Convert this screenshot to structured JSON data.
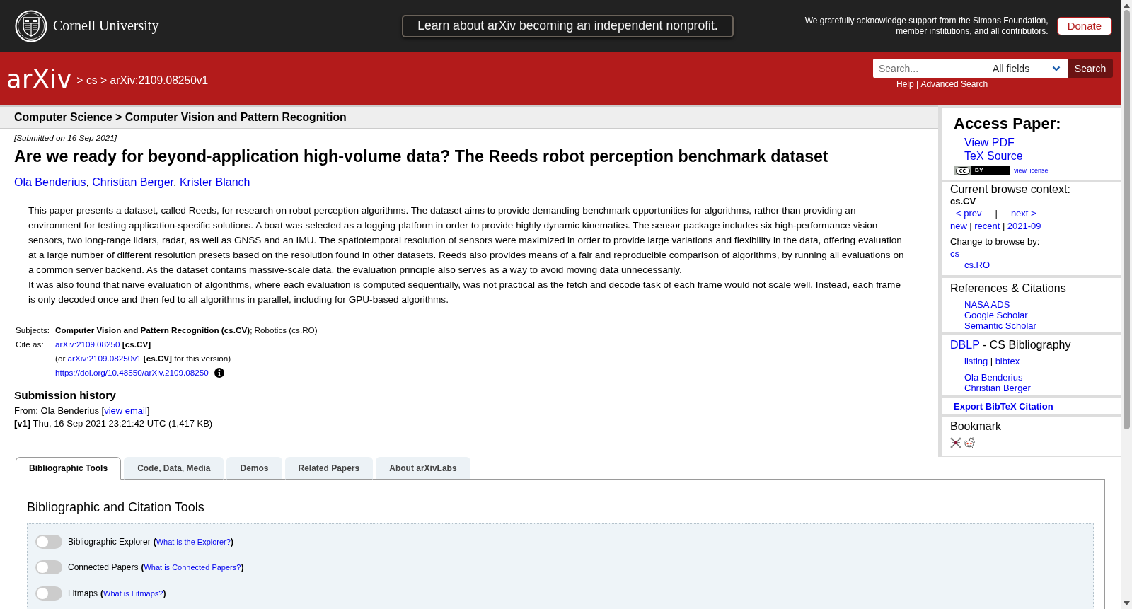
{
  "top_bar": {
    "university": "Cornell University",
    "announcement": "Learn about arXiv becoming an independent nonprofit.",
    "support_text": [
      {
        "kind": "text",
        "text": "We gratefully acknowledge support from the Simons Foundation, "
      },
      {
        "kind": "link",
        "text": "member institutions"
      },
      {
        "kind": "text",
        "text": ", and all contributors."
      }
    ],
    "donate_button": "Donate"
  },
  "header": {
    "logo": "arXiv",
    "breadcrumbs": [
      {
        "kind": "text",
        "text": ">"
      },
      {
        "kind": "link",
        "text": "cs"
      },
      {
        "kind": "text",
        "text": ">"
      },
      {
        "kind": "link",
        "text": "arXiv:2109.08250v1"
      }
    ],
    "search": {
      "placeholder": "Search...",
      "field": "All fields",
      "button": "Search"
    },
    "help_links": [
      {
        "kind": "link",
        "text": "Help"
      },
      {
        "kind": "text",
        "text": "|"
      },
      {
        "kind": "link",
        "text": "Advanced Search"
      }
    ]
  },
  "category_bar": "Computer Science > Computer Vision and Pattern Recognition",
  "paper": {
    "submitted": "[Submitted on 16 Sep 2021]",
    "title": "Are we ready for beyond-application high-volume data? The Reeds robot perception benchmark dataset",
    "authors": [
      {
        "kind": "link",
        "text": "Ola Benderius"
      },
      {
        "kind": "text",
        "text": ", "
      },
      {
        "kind": "link",
        "text": "Christian Berger"
      },
      {
        "kind": "text",
        "text": ", "
      },
      {
        "kind": "link",
        "text": "Krister Blanch"
      }
    ],
    "abstract": [
      "This paper presents a dataset, called Reeds, for research on robot perception algorithms. The dataset aims to provide demanding benchmark opportunities for algorithms, rather than providing an environment for testing application-specific solutions. A boat was selected as a logging platform in order to provide highly dynamic kinematics. The sensor package includes six high-performance vision sensors, two long-range lidars, radar, as well as GNSS and an IMU. The spatiotemporal resolution of sensors were maximized in order to provide large variations and flexibility in the data, offering evaluation at a large number of different resolution presets based on the resolution found in other datasets. Reeds also provides means of a fair and reproducible comparison of algorithms, by running all evaluations on a common server backend. As the dataset contains massive-scale data, the evaluation principle also serves as a way to avoid moving data unnecessarily.",
      "It was also found that naive evaluation of algorithms, where each evaluation is computed sequentially, was not practical as the fetch and decode task of each frame would not scale well. Instead, each frame is only decoded once and then fed to all algorithms in parallel, including for GPU-based algorithms."
    ],
    "metadata": [
      {
        "label": "Subjects:",
        "lines": [
          [
            {
              "kind": "bold",
              "text": "Computer Vision and Pattern Recognition (cs.CV)"
            },
            {
              "kind": "text",
              "text": "; Robotics (cs.RO)"
            }
          ]
        ]
      },
      {
        "label": "Cite as:",
        "lines": [
          [
            {
              "kind": "link",
              "text": "arXiv:2109.08250"
            },
            {
              "kind": "bold",
              "text": " [cs.CV]"
            }
          ],
          [
            {
              "kind": "text",
              "text": "(or "
            },
            {
              "kind": "link",
              "text": "arXiv:2109.08250v1"
            },
            {
              "kind": "bold",
              "text": " [cs.CV]"
            },
            {
              "kind": "text",
              "text": " for this version)"
            }
          ],
          [
            {
              "kind": "link",
              "text": "https://doi.org/10.48550/arXiv.2109.08250"
            },
            {
              "kind": "info"
            }
          ]
        ]
      }
    ],
    "submission_history": {
      "heading": "Submission history",
      "from": [
        {
          "kind": "text",
          "text": "From: Ola Benderius ["
        },
        {
          "kind": "link",
          "text": "view email"
        },
        {
          "kind": "text",
          "text": "]"
        }
      ],
      "versions": [
        {
          "version": "[v1]",
          "details": "Thu, 16 Sep 2021 23:21:42 UTC (1,417 KB)"
        }
      ]
    }
  },
  "sidebar": {
    "access_paper": {
      "heading": "Access Paper:",
      "links": [
        "View PDF",
        "TeX Source"
      ],
      "license": {
        "badge": "BY",
        "link": "view license"
      }
    },
    "browse_context": {
      "heading": "Current browse context:",
      "context": "cs.CV",
      "pager": [
        {
          "kind": "link",
          "text": "< prev"
        },
        {
          "kind": "text",
          "text": "|"
        },
        {
          "kind": "link",
          "text": "next >"
        }
      ],
      "lists": [
        {
          "kind": "link",
          "text": "new"
        },
        {
          "kind": "text",
          "text": "|"
        },
        {
          "kind": "link",
          "text": "recent"
        },
        {
          "kind": "text",
          "text": "|"
        },
        {
          "kind": "link",
          "text": "2021-09"
        }
      ],
      "change_label": "Change to browse by:",
      "categories": [
        {
          "label": "cs",
          "children": [
            {
              "label": "cs.RO"
            }
          ]
        }
      ]
    },
    "references": {
      "heading": "References & Citations",
      "links": [
        "NASA ADS",
        "Google Scholar",
        "Semantic Scholar"
      ]
    },
    "dblp": {
      "heading": [
        {
          "kind": "link",
          "text": "DBLP"
        },
        {
          "kind": "text",
          "text": " - CS Bibliography"
        }
      ],
      "links": [
        {
          "kind": "link",
          "text": "listing"
        },
        {
          "kind": "text",
          "text": "|"
        },
        {
          "kind": "link",
          "text": "bibtex"
        }
      ],
      "authors": [
        "Ola Benderius",
        "Christian Berger"
      ]
    },
    "export_citation": "Export BibTeX Citation",
    "bookmark": {
      "heading": "Bookmark"
    }
  },
  "tabs": [
    {
      "label": "Bibliographic Tools",
      "selected": true
    },
    {
      "label": "Code, Data, Media",
      "selected": false
    },
    {
      "label": "Demos",
      "selected": false
    },
    {
      "label": "Related Papers",
      "selected": false
    },
    {
      "label": "About arXivLabs",
      "selected": false
    }
  ],
  "tools_panel": {
    "heading": "Bibliographic and Citation Tools",
    "toggles": [
      {
        "label": "Bibliographic Explorer",
        "on": false,
        "help": [
          {
            "kind": "bold",
            "text": "("
          },
          {
            "kind": "link",
            "text": "What is the Explorer?"
          },
          {
            "kind": "bold",
            "text": ")"
          }
        ]
      },
      {
        "label": "Connected Papers",
        "on": false,
        "help": [
          {
            "kind": "bold",
            "text": "("
          },
          {
            "kind": "link",
            "text": "What is Connected Papers?"
          },
          {
            "kind": "bold",
            "text": ")"
          }
        ]
      },
      {
        "label": "Litmaps",
        "on": false,
        "help": [
          {
            "kind": "bold",
            "text": "("
          },
          {
            "kind": "link",
            "text": "What is Litmaps?"
          },
          {
            "kind": "bold",
            "text": ")"
          }
        ]
      }
    ]
  }
}
